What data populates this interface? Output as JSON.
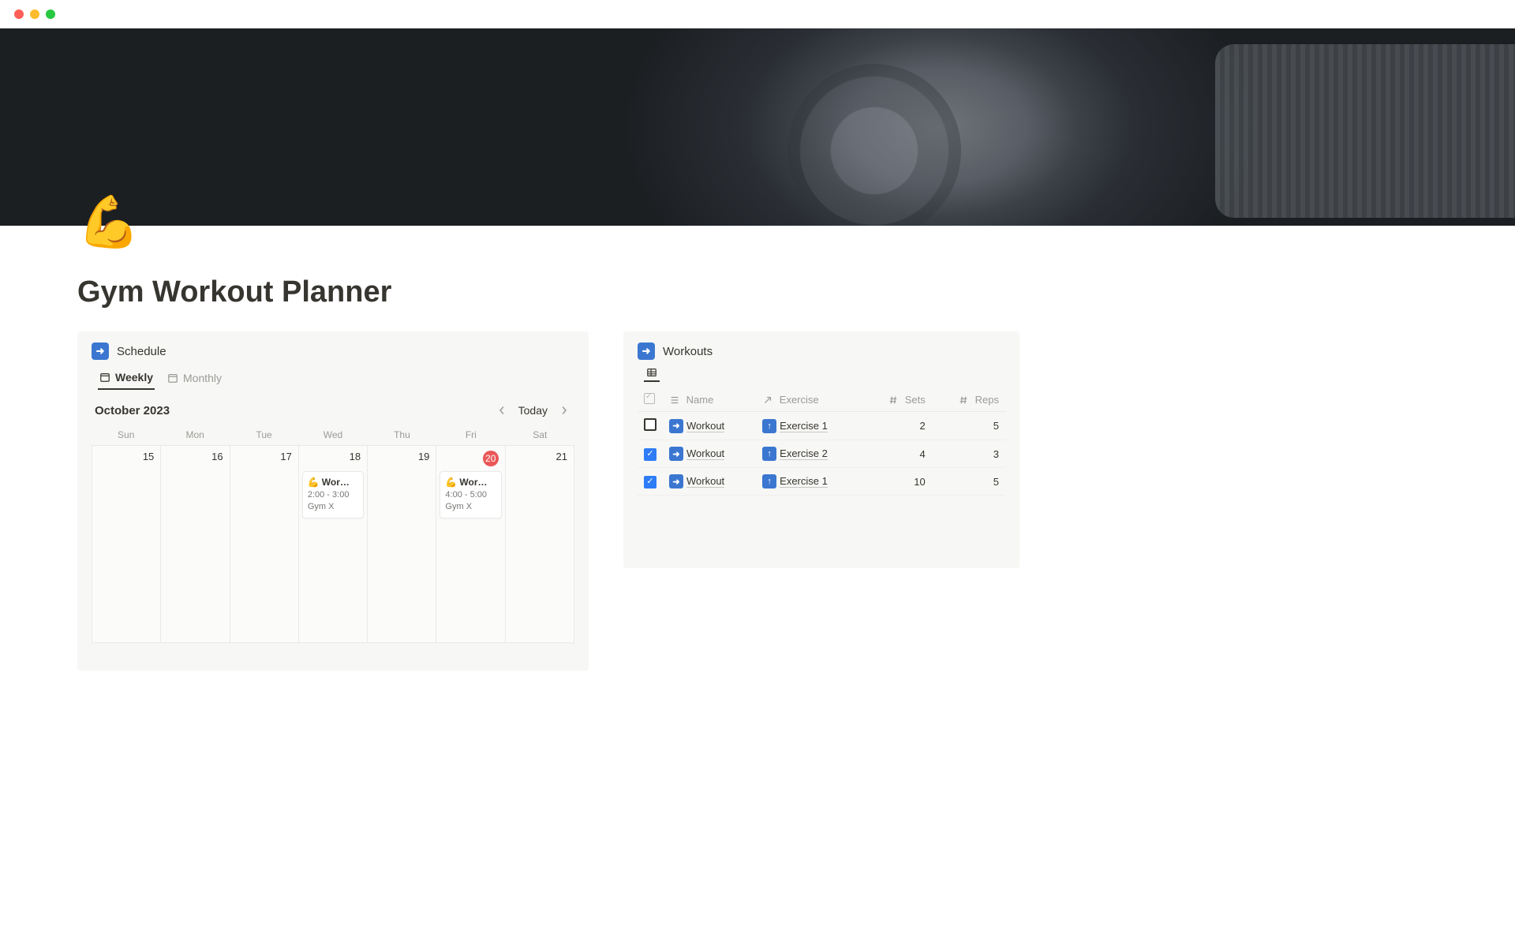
{
  "window": {
    "traffic": [
      "red",
      "yellow",
      "green"
    ]
  },
  "page": {
    "icon": "💪",
    "title": "Gym Workout Planner"
  },
  "schedule": {
    "panel_icon": "➡️",
    "panel_title": "Schedule",
    "tabs": {
      "weekly": "Weekly",
      "monthly": "Monthly"
    },
    "month_label": "October 2023",
    "today_label": "Today",
    "weekdays": [
      "Sun",
      "Mon",
      "Tue",
      "Wed",
      "Thu",
      "Fri",
      "Sat"
    ],
    "days": [
      {
        "date": "15",
        "today": false,
        "events": []
      },
      {
        "date": "16",
        "today": false,
        "events": []
      },
      {
        "date": "17",
        "today": false,
        "events": []
      },
      {
        "date": "18",
        "today": false,
        "events": [
          {
            "icon": "💪",
            "title": "Wor…",
            "time": "2:00 - 3:00",
            "location": "Gym X"
          }
        ]
      },
      {
        "date": "19",
        "today": false,
        "events": []
      },
      {
        "date": "20",
        "today": true,
        "events": [
          {
            "icon": "💪",
            "title": "Wor…",
            "time": "4:00 - 5:00",
            "location": "Gym X"
          }
        ]
      },
      {
        "date": "21",
        "today": false,
        "events": []
      }
    ]
  },
  "workouts": {
    "panel_icon": "➡️",
    "panel_title": "Workouts",
    "columns": {
      "name": "Name",
      "exercise": "Exercise",
      "sets": "Sets",
      "reps": "Reps"
    },
    "rows": [
      {
        "checked": false,
        "name_icon": "➡️",
        "name": "Workout",
        "exercise_icon": "⬆️",
        "exercise": "Exercise 1",
        "sets": "2",
        "reps": "5"
      },
      {
        "checked": true,
        "name_icon": "➡️",
        "name": "Workout",
        "exercise_icon": "⬆️",
        "exercise": "Exercise 2",
        "sets": "4",
        "reps": "3"
      },
      {
        "checked": true,
        "name_icon": "➡️",
        "name": "Workout",
        "exercise_icon": "⬆️",
        "exercise": "Exercise 1",
        "sets": "10",
        "reps": "5"
      }
    ]
  }
}
